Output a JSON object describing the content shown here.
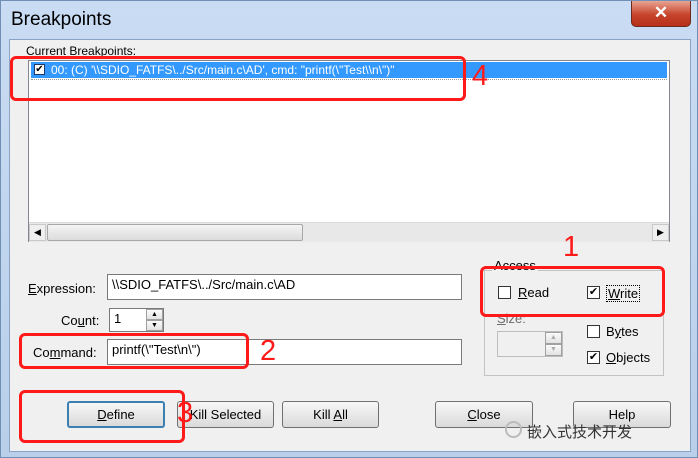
{
  "window": {
    "title": "Breakpoints",
    "close_glyph": "✕"
  },
  "breakpoints": {
    "label": "Current Breakpoints:",
    "items": [
      {
        "checked": true,
        "text": "00: (C) '\\\\SDIO_FATFS\\../Src/main.c\\AD', cmd: \"printf(\\\"Test\\\\n\\\")\""
      }
    ]
  },
  "expression": {
    "label_u": "E",
    "label_rest": "xpression:",
    "value": "\\\\SDIO_FATFS\\../Src/main.c\\AD"
  },
  "count": {
    "label_pre": "Co",
    "label_u": "u",
    "label_rest": "nt:",
    "value": "1"
  },
  "command": {
    "label_pre": "Co",
    "label_u": "m",
    "label_rest": "mand:",
    "value": "printf(\\\"Test\\n\\\")"
  },
  "access": {
    "legend": "Access",
    "read": {
      "label_u": "R",
      "label_rest": "ead",
      "checked": false
    },
    "write": {
      "label_u": "W",
      "label_rest": "rite",
      "checked": true
    },
    "size_label_u": "S",
    "size_label_rest": "ize:",
    "bytes": {
      "label_pre": "B",
      "label_u": "y",
      "label_rest": "tes",
      "checked": false
    },
    "objects": {
      "label_u": "O",
      "label_rest": "bjects",
      "checked": true
    }
  },
  "buttons": {
    "define": {
      "label_u": "D",
      "label_rest": "efine"
    },
    "kill_selected": {
      "label": "Kill Selected"
    },
    "kill_all": {
      "label_pre": "Kill ",
      "label_u": "A",
      "label_rest": "ll"
    },
    "close": {
      "label_u": "C",
      "label_rest": "lose"
    },
    "help": {
      "label": "Help"
    }
  },
  "annotations": [
    "1",
    "2",
    "3",
    "4"
  ],
  "watermark": {
    "text": "嵌入式技术开发"
  },
  "colors": {
    "annotation": "#ff1a1a",
    "selection": "#3399ff"
  }
}
